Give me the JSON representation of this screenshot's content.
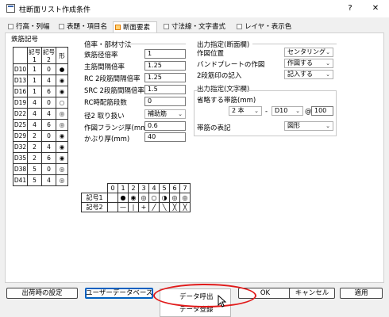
{
  "window": {
    "title": "柱断面リスト作成条件",
    "help_glyph": "?",
    "close_glyph": "✕"
  },
  "tabs": [
    {
      "label": "行高・列幅"
    },
    {
      "label": "表題・項目名"
    },
    {
      "label": "断面要素",
      "active": true
    },
    {
      "label": "寸法線・文字書式"
    },
    {
      "label": "レイヤ・表示色"
    }
  ],
  "rebar_table": {
    "title": "鉄筋記号",
    "headers": [
      "記号1",
      "記号2",
      "形"
    ],
    "rows": [
      {
        "name": "D10",
        "k1": "1",
        "k2": "0",
        "shape": "●"
      },
      {
        "name": "D13",
        "k1": "1",
        "k2": "4",
        "shape": "◉"
      },
      {
        "name": "D16",
        "k1": "1",
        "k2": "6",
        "shape": "◉"
      },
      {
        "name": "D19",
        "k1": "4",
        "k2": "0",
        "shape": "○"
      },
      {
        "name": "D22",
        "k1": "4",
        "k2": "4",
        "shape": "◎"
      },
      {
        "name": "D25",
        "k1": "4",
        "k2": "6",
        "shape": "◎"
      },
      {
        "name": "D29",
        "k1": "2",
        "k2": "0",
        "shape": "◉"
      },
      {
        "name": "D32",
        "k1": "2",
        "k2": "4",
        "shape": "◉"
      },
      {
        "name": "D35",
        "k1": "2",
        "k2": "6",
        "shape": "◉"
      },
      {
        "name": "D38",
        "k1": "5",
        "k2": "0",
        "shape": "◎"
      },
      {
        "name": "D41",
        "k1": "5",
        "k2": "4",
        "shape": "◎"
      }
    ]
  },
  "ratios": {
    "title": "倍率・部材寸法",
    "rows": [
      {
        "label": "鉄筋径倍率",
        "value": "1"
      },
      {
        "label": "主筋間隔倍率",
        "value": "1.25"
      },
      {
        "label": "RC 2段筋間隔倍率",
        "value": "1.25"
      },
      {
        "label": "SRC 2段筋間隔倍率",
        "value": "1.5"
      },
      {
        "label": "RC時配筋段数",
        "value": "0"
      }
    ],
    "diameter_label": "径2 取り扱い",
    "diameter_value": "補助筋",
    "flange_label": "作図フランジ厚(mm)",
    "flange_value": "0.6",
    "cover_label": "かぶり厚(mm)",
    "cover_value": "40"
  },
  "output_section": {
    "title": "出力指定(断面欄)",
    "rows": [
      {
        "label": "作図位置",
        "value": "センタリング"
      },
      {
        "label": "バンドプレートの作図",
        "value": "作図する"
      },
      {
        "label": "2段筋印の記入",
        "value": "記入する"
      }
    ]
  },
  "output_text": {
    "title": "出力指定(文字欄)",
    "abbrev_label": "省略する帯筋(mm)",
    "count": "2 本",
    "dash": "-",
    "bar": "D10",
    "at": "@",
    "pitch": "100",
    "notation_label": "帯筋の表記",
    "notation_value": "図形"
  },
  "symbol_table": {
    "numbers": [
      "0",
      "1",
      "2",
      "3",
      "4",
      "5",
      "6",
      "7"
    ],
    "row1_label": "記号1",
    "row1": [
      "",
      "●",
      "◉",
      "◎",
      "○",
      "◑",
      "◎",
      "◎"
    ],
    "row2_label": "記号2",
    "row2": [
      "",
      "—",
      "|",
      "+",
      "╱",
      "╲",
      "╳",
      "╳"
    ]
  },
  "buttons": {
    "default": "出荷時の設定",
    "userdb": "ユーザーデータベース",
    "ok": "OK",
    "cancel": "キャンセル",
    "apply": "適用"
  },
  "menu": {
    "items": [
      "データ呼出",
      "データ登録"
    ]
  }
}
